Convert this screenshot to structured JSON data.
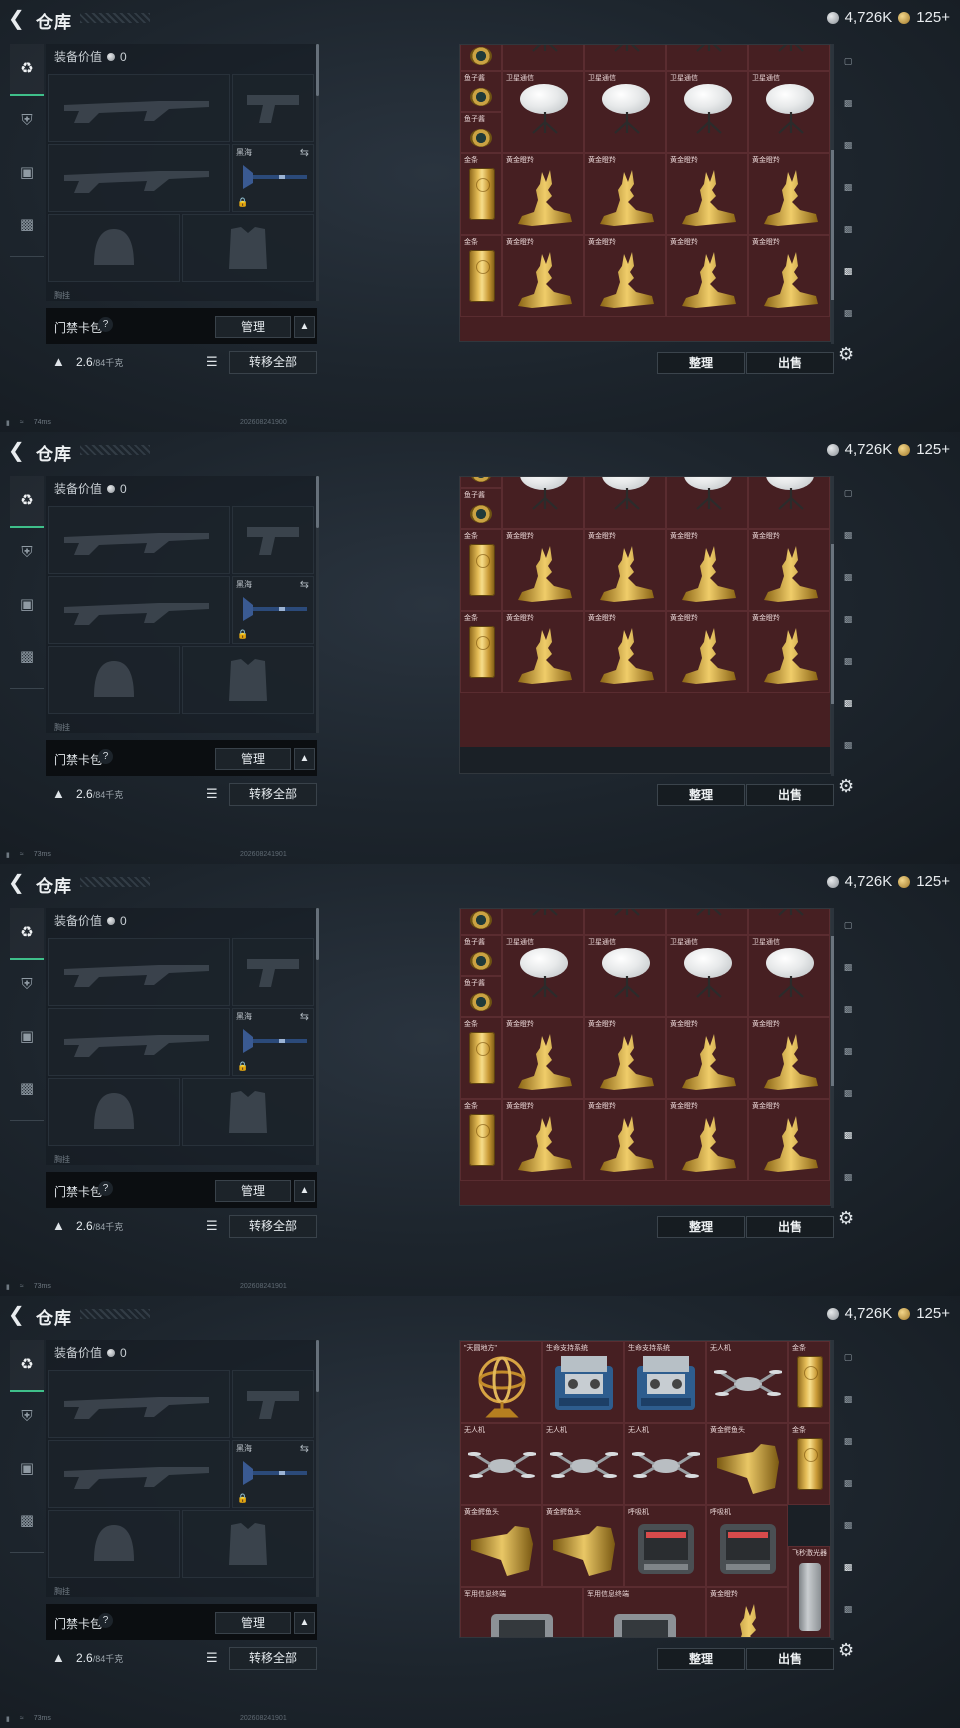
{
  "header": {
    "back_icon": "back-arrow-icon",
    "title": "仓库",
    "silver": "4,726K",
    "gold": "125+"
  },
  "loadout": {
    "equip_value_label": "装备价值",
    "equip_value": "0",
    "melee_name": "黑海",
    "peek_label": "胸挂",
    "cardbag_label": "门禁卡包",
    "help": "?",
    "manage": "管理",
    "weight": "2.6",
    "weight_max": "/84千克",
    "transfer_all": "转移全部"
  },
  "stash": {
    "sort": "整理",
    "sell": "出售"
  },
  "items": {
    "compass": "鱼子酱",
    "satellite": "卫星通信",
    "bar": "金条",
    "deer": "黄金瞪羚",
    "gyro": "\"天圆地方\"",
    "life": "生命支持系统",
    "drone": "无人机",
    "croc": "黄金鳄鱼头",
    "resp": "呼吸机",
    "flash": "飞秒激光器",
    "terminal": "军用信息终端"
  },
  "panels": [
    {
      "ping": "74ms",
      "stamp": "202608241900"
    },
    {
      "ping": "73ms",
      "stamp": "202608241901"
    },
    {
      "ping": "73ms",
      "stamp": "202608241901"
    },
    {
      "ping": "73ms",
      "stamp": "202608241901"
    }
  ]
}
